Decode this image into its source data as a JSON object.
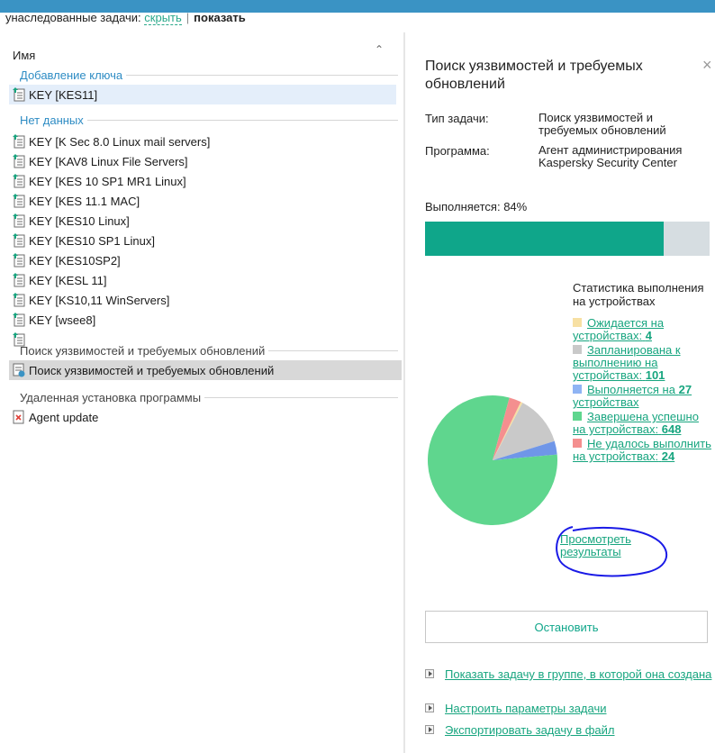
{
  "inherited": {
    "label": "унаследованные задачи:",
    "hide": "скрыть",
    "separator": "|",
    "show": "показать"
  },
  "list": {
    "column_header": "Имя",
    "groups": [
      {
        "title": "Добавление ключа",
        "items": [
          "KEY [KES11]"
        ]
      },
      {
        "title": "Нет данных",
        "items": [
          "KEY [K Sec 8.0 Linux mail servers]",
          "KEY [KAV8 Linux File Servers]",
          "KEY [KES 10 SP1 MR1 Linux]",
          "KEY [KES 11.1 MAC]",
          "KEY [KES10 Linux]",
          "KEY [KES10 SP1 Linux]",
          "KEY [KES10SP2]",
          "KEY [KESL 11]",
          "KEY [KS10,11 WinServers]",
          "KEY [wsee8]"
        ]
      },
      {
        "title": "Поиск уязвимостей и требуемых обновлений",
        "items": [
          "Поиск уязвимостей и требуемых обновлений"
        ]
      },
      {
        "title": "Удаленная установка программы",
        "items": [
          "Agent update"
        ]
      }
    ]
  },
  "panel": {
    "title": "Поиск уязвимостей и требуемых обновлений",
    "close": "×",
    "task_type_label": "Тип задачи:",
    "task_type_value": "Поиск уязвимостей и требуемых обновлений",
    "program_label": "Программа:",
    "program_value": "Агент администрирования Kaspersky Security Center",
    "progress_label": "Выполняется:",
    "progress_text": "84%",
    "progress": 0.84,
    "stats_title": "Статистика выполнения на устройствах",
    "stats": [
      {
        "label": "Ожидается на устройствах:",
        "count": "4",
        "color": "#f7e0a3"
      },
      {
        "label": "Запланирована к выполнению на устройствах:",
        "count": "101",
        "color": "#c9c9c9"
      },
      {
        "label": "Выполняется на",
        "count": "27",
        "suffix": "устройствах",
        "color": "#8fb4f4"
      },
      {
        "label": "Завершена успешно на устройствах:",
        "count": "648",
        "color": "#5fd68e"
      },
      {
        "label": "Не удалось выполнить на устройствах:",
        "count": "24",
        "color": "#f48f8f"
      }
    ],
    "results_link": "Просмотреть результаты",
    "stop_button": "Остановить",
    "actions": [
      "Показать задачу в группе, в которой она создана",
      "Настроить параметры задачи",
      "Экспортировать задачу в файл"
    ]
  },
  "chart_data": {
    "type": "pie",
    "labels": [
      "Ожидается",
      "Запланирована",
      "Выполняется",
      "Завершена успешно",
      "Не удалось"
    ],
    "values": [
      4,
      101,
      27,
      648,
      24
    ],
    "colors": [
      "#f7e0a3",
      "#c9c9c9",
      "#6f96e8",
      "#5fd68e",
      "#f48f8f"
    ]
  },
  "colors": {
    "accent": "#0fa68a",
    "link": "#17a57f",
    "header_bar": "#3a93c4"
  }
}
